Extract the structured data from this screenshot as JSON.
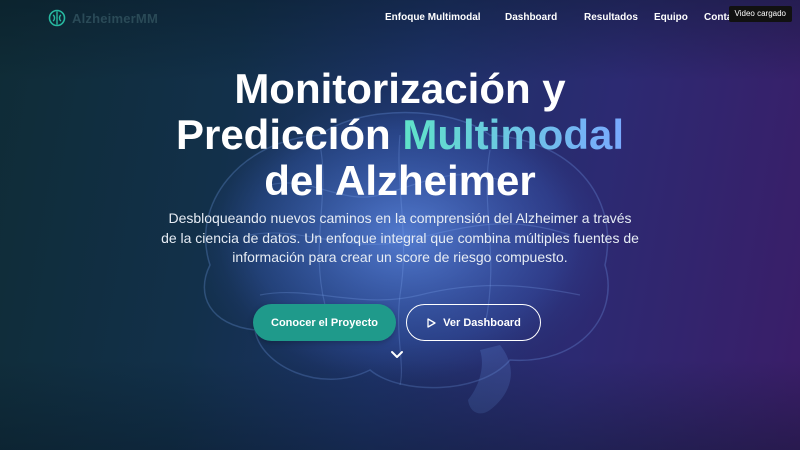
{
  "brand": {
    "name": "AlzheimerMM",
    "accent": "#1f9a8b",
    "gradient_from": "#5fe3c8",
    "gradient_to": "#79a9ff"
  },
  "nav": {
    "items": [
      {
        "label": "Enfoque Multimodal"
      },
      {
        "label": "Dashboard"
      },
      {
        "label": "Resultados"
      },
      {
        "label": "Equipo"
      },
      {
        "label": "Contacto"
      }
    ]
  },
  "toast": {
    "text": "Video cargado"
  },
  "hero": {
    "title_line1": "Monitorización y",
    "title_line2_prefix": "Predicción ",
    "title_line2_accent": "Multimodal",
    "title_line3": "del Alzheimer",
    "description": "Desbloqueando nuevos caminos en la comprensión del Alzheimer a través de la ciencia de datos. Un enfoque integral que combina múltiples fuentes de información para crear un score de riesgo compuesto.",
    "cta_primary": "Conocer el Proyecto",
    "cta_secondary": "Ver Dashboard",
    "cta_secondary_icon": "play-icon",
    "scroll_icon": "chevron-down-icon"
  }
}
